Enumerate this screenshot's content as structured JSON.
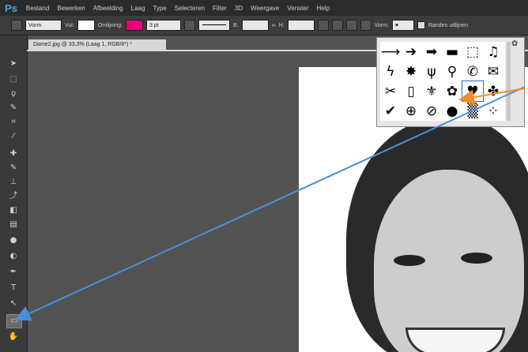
{
  "app": {
    "logo": "Ps"
  },
  "menu": [
    "Bestand",
    "Bewerken",
    "Afbeelding",
    "Laag",
    "Type",
    "Selecteren",
    "Filter",
    "3D",
    "Weergave",
    "Venster",
    "Help"
  ],
  "options": {
    "tool_mode": "Vorm",
    "fill_label": "Vul:",
    "stroke_label": "Omlijning:",
    "stroke_color": "#e6007e",
    "stroke_width": "3 pt",
    "w_label": "B:",
    "h_label": "H:",
    "shape_label": "Vorm:",
    "align_edges_label": "Randen uitlijnen"
  },
  "document": {
    "tab_title": "Dame2.jpg @ 33,3% (Laag 1, RGB/8*) *"
  },
  "shape_picker": {
    "shapes": [
      "⟶",
      "➔",
      "➡",
      "▬",
      "⬚",
      "♫",
      "ϟ",
      "✸",
      "ψ",
      "⚲",
      "✆",
      "✉",
      "✂",
      "▯",
      "⚜",
      "✿",
      "♥",
      "✤",
      "✔",
      "⊕",
      "⊘",
      "●",
      "▒",
      "⁘"
    ],
    "selected_index": 16
  },
  "annotation_colors": {
    "blue": "#4a90d9",
    "orange": "#f28c28"
  }
}
